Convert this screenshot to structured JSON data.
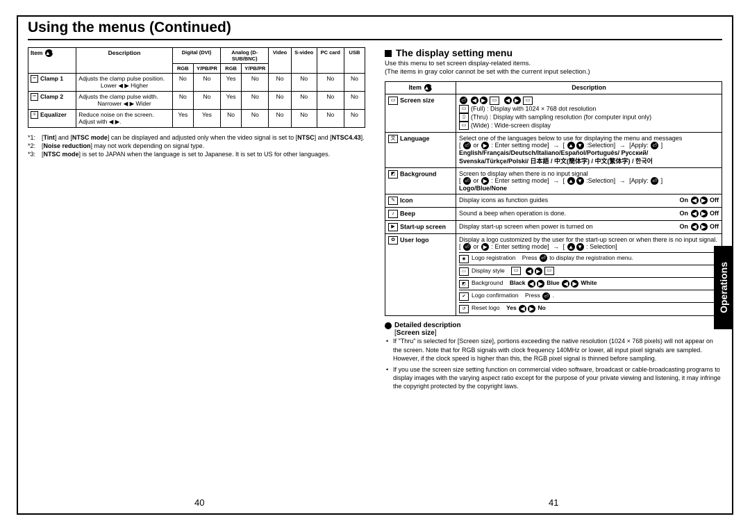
{
  "title": "Using the menus (Continued)",
  "left": {
    "table": {
      "headers": [
        "Item",
        "Description",
        "Digital (DVI)",
        "Analog (D-SUB/BNC)",
        "Video",
        "S-video",
        "PC card",
        "USB"
      ],
      "sub1": [
        "RGB",
        "Y/PB/PR",
        "RGB",
        "Y/PB/PR"
      ],
      "rows": [
        {
          "item": "Clamp 1",
          "desc": "Adjusts the clamp pulse position.",
          "adj": "Lower ◀ ▶ Higher",
          "v": [
            "No",
            "No",
            "Yes",
            "No",
            "No",
            "No",
            "No",
            "No"
          ]
        },
        {
          "item": "Clamp 2",
          "desc": "Adjusts the clamp pulse width.",
          "adj": "Narrower ◀ ▶ Wider",
          "v": [
            "No",
            "No",
            "Yes",
            "No",
            "No",
            "No",
            "No",
            "No"
          ]
        },
        {
          "item": "Equalizer",
          "desc": "Reduce noise on the screen.",
          "adj": "Adjust with ◀ ▶.",
          "v": [
            "Yes",
            "Yes",
            "No",
            "No",
            "No",
            "No",
            "No",
            "No"
          ]
        }
      ]
    },
    "notes": [
      {
        "n": "*1:",
        "t": "[Tint] and [NTSC mode] can be displayed and adjusted only when the video signal is set to [NTSC] and [NTSC4.43]."
      },
      {
        "n": "*2:",
        "t": "[Noise reduction] may not work depending on signal type."
      },
      {
        "n": "*3:",
        "t": "[NTSC mode] is set to JAPAN when the language is set to Japanese. It is set to US for other languages."
      }
    ],
    "page": "40"
  },
  "right": {
    "section_title": "The display setting menu",
    "intro1": "Use this menu to set screen display-related items.",
    "intro2": "(The items in gray color cannot be set with the current input selection.)",
    "th_item": "Item",
    "th_desc": "Description",
    "rows": {
      "screen_size": {
        "label": "Screen size",
        "sel": "◉ ◀ ▶ ⧈ ◀ ▶ ⧈",
        "o1": "(Full) : Display with 1024 × 768 dot resolution",
        "o2": "(Thru) : Display with sampling resolution (for computer input only)",
        "o3": "(Wide) : Wide-screen display"
      },
      "language": {
        "label": "Language",
        "l1": "Select one of the languages below to use for displaying the menu and messages",
        "l2": "[ ⏎ or ▶ : Enter setting mode] → [ ▲ ▼ :Selection] → [Apply: ⏎ ]",
        "l3": "English/Français/Deutsch/Italiano/Español/Português/ Русский/",
        "l4": "Svenska/Türkçe/Polski/ 日本語 / 中文(簡体字) / 中文(繁体字) / 한국어"
      },
      "background": {
        "label": "Background",
        "l1": "Screen to display when there is no input signal",
        "l2": "[ ⏎ or ▶ : Enter setting mode] → [ ▲ ▼ :Selection] → [Apply: ⏎ ]",
        "l3": "Logo/Blue/None"
      },
      "icon": {
        "label": "Icon",
        "l1": "Display icons as function guides",
        "onoff": "On ◀ ▶ Off"
      },
      "beep": {
        "label": "Beep",
        "l1": "Sound a beep when operation is done.",
        "onoff": "On ◀ ▶ Off"
      },
      "startup": {
        "label": "Start-up screen",
        "l1": "Display start-up screen when power is turned on",
        "onoff": "On ◀ ▶ Off"
      },
      "userlogo": {
        "label": "User logo",
        "l1": "Display a logo customized by the user for the start-up screen or when there is no input signal.",
        "l2": "[ ⏎ or ▶ : Enter setting mode] → [ ▲ ▼ : Selection]",
        "sub": [
          {
            "a": "Logo registration",
            "b": "Press ⏎ to display the registration menu."
          },
          {
            "a": "Display style",
            "b": "⧈  ◀ ▶  ⧈"
          },
          {
            "a": "Background",
            "b": "Black ◀ ▶ Blue ◀ ▶ White",
            "bold": true
          },
          {
            "a": "Logo confirmation",
            "b": "Press ⏎ ."
          },
          {
            "a": "Reset logo",
            "b": "Yes ◀ ▶ No",
            "bold": true
          }
        ]
      }
    },
    "dd_title": "Detailed description",
    "dd_sub": "[Screen size]",
    "dd": [
      "If \"Thru\" is selected for [Screen size], portions exceeding the native resolution (1024 × 768 pixels) will not appear on the screen. Note that for RGB signals with clock frequency 140MHz or lower, all input pixel signals are sampled. However, if the clock speed is higher than this, the RGB pixel signal is thinned before sampling.",
      "If you use the screen size setting function on commercial video software, broadcast or cable-broadcasting programs to display images with the varying aspect ratio except for the purpose of your private viewing and listening, it may infringe the copyright protected by the copyright laws."
    ],
    "page": "41",
    "sidetab": "Operations"
  }
}
